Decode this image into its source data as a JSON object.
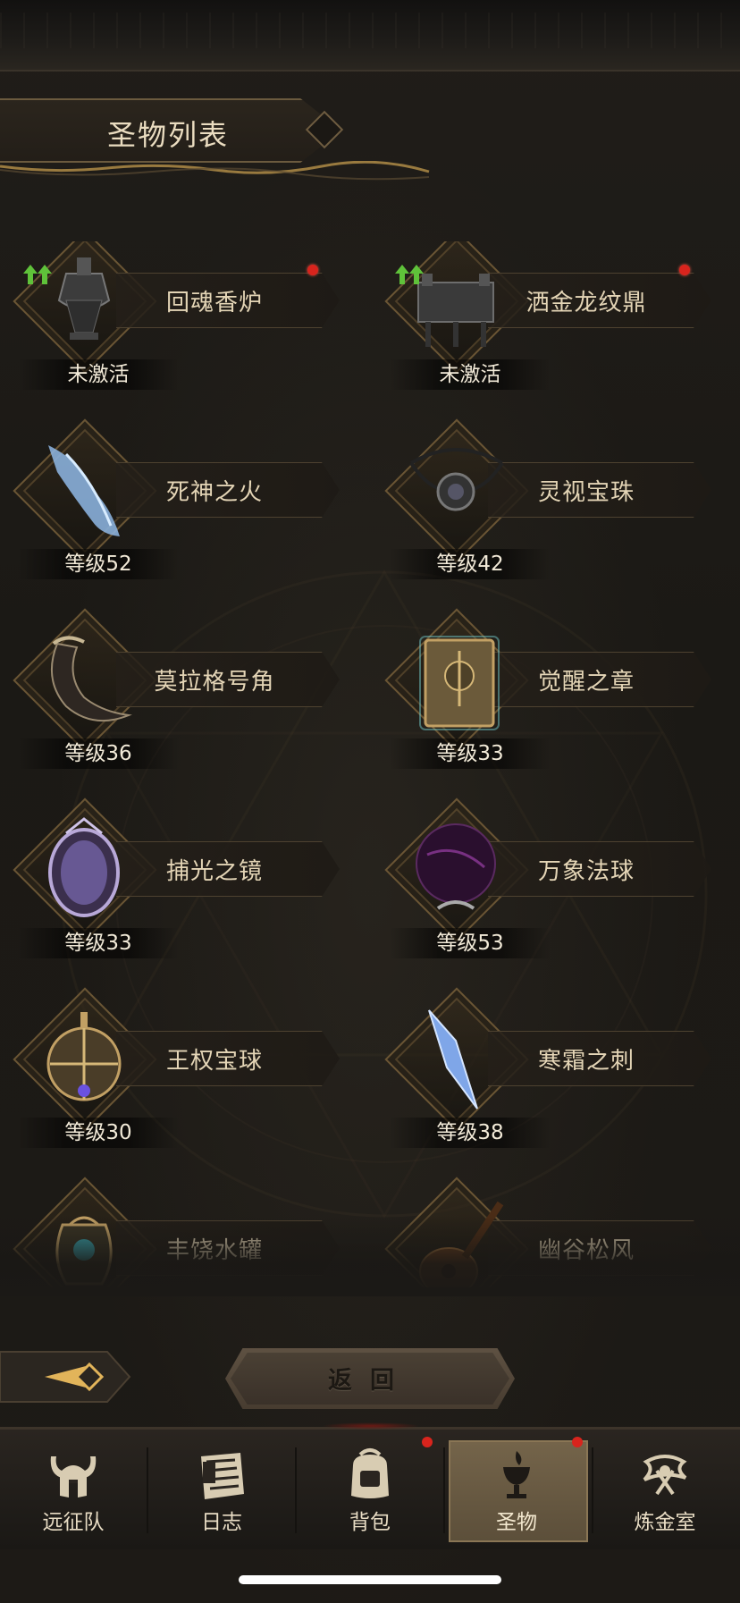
{
  "header": {
    "title": "圣物列表"
  },
  "relics": [
    {
      "name": "回魂香炉",
      "status": "未激活",
      "upgrade": true,
      "red_dot": true,
      "art": "censer"
    },
    {
      "name": "洒金龙纹鼎",
      "status": "未激活",
      "upgrade": true,
      "red_dot": true,
      "art": "cauldron"
    },
    {
      "name": "死神之火",
      "status": "等级52",
      "upgrade": false,
      "red_dot": false,
      "art": "ghost-hand"
    },
    {
      "name": "灵视宝珠",
      "status": "等级42",
      "upgrade": false,
      "red_dot": false,
      "art": "amulet"
    },
    {
      "name": "莫拉格号角",
      "status": "等级36",
      "upgrade": false,
      "red_dot": false,
      "art": "horn"
    },
    {
      "name": "觉醒之章",
      "status": "等级33",
      "upgrade": false,
      "red_dot": false,
      "art": "tome"
    },
    {
      "name": "捕光之镜",
      "status": "等级33",
      "upgrade": false,
      "red_dot": false,
      "art": "mirror"
    },
    {
      "name": "万象法球",
      "status": "等级53",
      "upgrade": false,
      "red_dot": false,
      "art": "dark-orb"
    },
    {
      "name": "王权宝球",
      "status": "等级30",
      "upgrade": false,
      "red_dot": false,
      "art": "royal-orb"
    },
    {
      "name": "寒霜之刺",
      "status": "等级38",
      "upgrade": false,
      "red_dot": false,
      "art": "frost-shard"
    },
    {
      "name": "丰饶水罐",
      "status": "",
      "upgrade": false,
      "red_dot": false,
      "art": "water-jar"
    },
    {
      "name": "幽谷松风",
      "status": "",
      "upgrade": false,
      "red_dot": false,
      "art": "lute"
    }
  ],
  "back_button": {
    "label": "返回"
  },
  "tabs": [
    {
      "label": "远征队",
      "icon": "horned-helmet-icon",
      "active": false,
      "red_dot": false
    },
    {
      "label": "日志",
      "icon": "scroll-icon",
      "active": false,
      "red_dot": false
    },
    {
      "label": "背包",
      "icon": "backpack-icon",
      "active": false,
      "red_dot": true
    },
    {
      "label": "圣物",
      "icon": "chalice-icon",
      "active": true,
      "red_dot": true
    },
    {
      "label": "炼金室",
      "icon": "alchemy-icon",
      "active": false,
      "red_dot": false
    }
  ],
  "colors": {
    "accent_gold": "#6a5534",
    "text": "#e4d5b6",
    "red_dot": "#d8241d",
    "upgrade_green": "#5fc23a"
  }
}
